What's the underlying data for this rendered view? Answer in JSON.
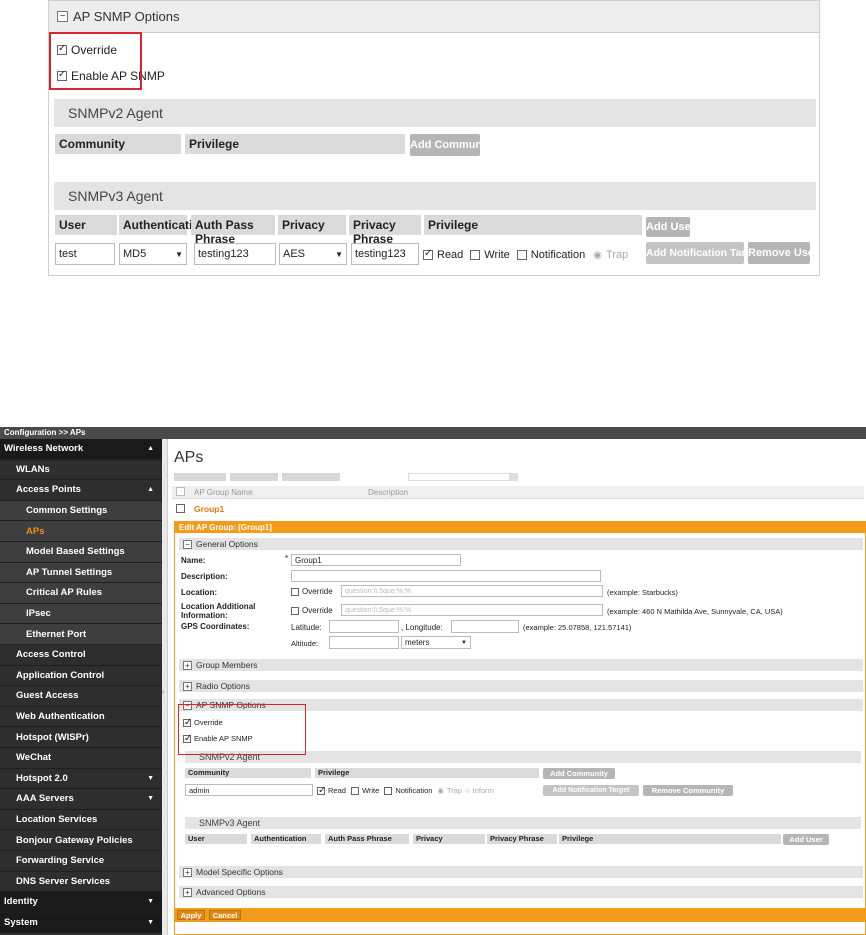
{
  "top": {
    "section_title": "AP SNMP Options",
    "override_label": "Override",
    "enable_label": "Enable AP SNMP",
    "snmpv2_title": "SNMPv2 Agent",
    "v2_cols": [
      "Community",
      "Privilege"
    ],
    "add_community": "Add Community",
    "snmpv3_title": "SNMPv3 Agent",
    "v3_cols": [
      "User",
      "Authentication",
      "Auth Pass Phrase",
      "Privacy",
      "Privacy Phrase",
      "Privilege"
    ],
    "add_user": "Add User",
    "row": {
      "user": "test",
      "auth": "MD5",
      "auth_pass": "testing123",
      "privacy": "AES",
      "privacy_phrase": "testing123",
      "read": "Read",
      "write": "Write",
      "notification": "Notification",
      "trap": "Trap"
    },
    "add_notification_target": "Add Notification Target",
    "remove_user": "Remove User"
  },
  "app": {
    "breadcrumb": "Configuration >> APs",
    "page_title": "APs",
    "sidebar": [
      {
        "label": "Wireless Network",
        "level": 0,
        "caret": "▲"
      },
      {
        "label": "WLANs",
        "level": 1
      },
      {
        "label": "Access Points",
        "level": 1,
        "caret": "▲"
      },
      {
        "label": "Common Settings",
        "level": 2
      },
      {
        "label": "APs",
        "level": 2,
        "active": true
      },
      {
        "label": "Model Based Settings",
        "level": 2
      },
      {
        "label": "AP Tunnel Settings",
        "level": 2
      },
      {
        "label": "Critical AP Rules",
        "level": 2
      },
      {
        "label": "IPsec",
        "level": 2
      },
      {
        "label": "Ethernet Port",
        "level": 2
      },
      {
        "label": "Access Control",
        "level": 1
      },
      {
        "label": "Application Control",
        "level": 1
      },
      {
        "label": "Guest Access",
        "level": 1
      },
      {
        "label": "Web Authentication",
        "level": 1
      },
      {
        "label": "Hotspot (WISPr)",
        "level": 1
      },
      {
        "label": "WeChat",
        "level": 1
      },
      {
        "label": "Hotspot 2.0",
        "level": 1,
        "caret": "▼"
      },
      {
        "label": "AAA Servers",
        "level": 1,
        "caret": "▼"
      },
      {
        "label": "Location Services",
        "level": 1
      },
      {
        "label": "Bonjour Gateway Policies",
        "level": 1
      },
      {
        "label": "Forwarding Service",
        "level": 1
      },
      {
        "label": "DNS Server Services",
        "level": 1
      },
      {
        "label": "Identity",
        "level": 0,
        "caret": "▼"
      },
      {
        "label": "System",
        "level": 0,
        "caret": "▼"
      }
    ],
    "table": {
      "col_name": "AP Group Name",
      "col_desc": "Description",
      "group_row": "Group1"
    },
    "edit_header": "Edit AP Group: [Group1]",
    "general": {
      "title": "General Options",
      "name_label": "Name:",
      "name_value": "Group1",
      "desc_label": "Description:",
      "location_label": "Location:",
      "override": "Override",
      "location_placeholder": "question:\\\\:5que:%:%",
      "location_example": "(example: Starbucks)",
      "loc_add_label": "Location Additional Information:",
      "loc_add_placeholder": "question:\\\\:5que:%:%",
      "loc_add_example": "(example: 460 N Mathilda Ave, Sunnyvale, CA, USA)",
      "gps_label": "GPS Coordinates:",
      "latitude": "Latitude:",
      "longitude": ", Longitude:",
      "gps_example": "(example: 25.07858, 121.57141)",
      "altitude": "Altitude:",
      "altitude_unit": "meters"
    },
    "group_members": "Group Members",
    "radio_options": "Radio Options",
    "snmp": {
      "title": "AP SNMP Options",
      "override": "Override",
      "enable": "Enable AP SNMP",
      "v2_title": "SNMPv2 Agent",
      "v2_community": "Community",
      "v2_privilege": "Privilege",
      "add_community": "Add Community",
      "community_value": "admin",
      "read": "Read",
      "write": "Write",
      "notification": "Notification",
      "trap": "Trap",
      "inform": "Inform",
      "add_notification_target": "Add Notification Target",
      "remove_community": "Remove Community",
      "v3_title": "SNMPv3 Agent",
      "v3_cols": [
        "User",
        "Authentication",
        "Auth Pass Phrase",
        "Privacy",
        "Privacy Phrase",
        "Privilege"
      ],
      "add_user": "Add User"
    },
    "model_specific": "Model Specific Options",
    "advanced": "Advanced Options",
    "apply": "Apply",
    "cancel": "Cancel"
  },
  "colors": {
    "highlight_red": "#d9262d",
    "orange": "#f39c1b",
    "sidebar_dark": "#2a2a2a",
    "active_orange": "#f18b1c"
  }
}
